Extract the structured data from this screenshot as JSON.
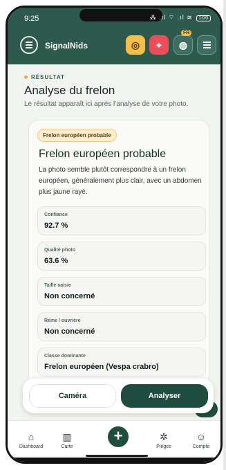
{
  "status": {
    "time": "9:25",
    "icons": "⁂ .ıl ⌔ .ıl ≋",
    "battery": "100"
  },
  "header": {
    "app_title": "SignalNids",
    "fr_badge": "FR",
    "buttons": [
      "target-icon",
      "pin-plus-icon",
      "globe-icon",
      "menu-icon"
    ]
  },
  "main": {
    "eyebrow": "RÉSULTAT",
    "title": "Analyse du frelon",
    "subtitle": "Le résultat apparaît ici après l’analyse de votre photo."
  },
  "result": {
    "pill": "Frelon européen probable",
    "title": "Frelon européen probable",
    "description": "La photo semble plutôt correspondre à un frelon européen, généralement plus clair, avec un abdomen plus jaune rayé.",
    "metrics": [
      {
        "label": "Confiance",
        "value": "92.7 %"
      },
      {
        "label": "Qualité photo",
        "value": "63.6 %"
      },
      {
        "label": "Taille saisie",
        "value": "Non concerné"
      },
      {
        "label": "Reine / ouvrière",
        "value": "Non concerné"
      },
      {
        "label": "Classe dominante",
        "value": "Frelon européen (Vespa crabro)"
      }
    ]
  },
  "actions": {
    "camera": "Caméra",
    "analyse": "Analyser"
  },
  "nav": {
    "items": [
      {
        "label": "Dashboard",
        "icon": "home-icon"
      },
      {
        "label": "Carte",
        "icon": "map-icon"
      },
      {
        "label": "Pièges",
        "icon": "bug-icon"
      },
      {
        "label": "Compte",
        "icon": "account-icon"
      }
    ],
    "add_icon": "plus-icon"
  },
  "colors": {
    "brand": "#2e5a4d",
    "accent_dark": "#1f4d40",
    "warning": "#f5c04a",
    "danger": "#ea4e58"
  }
}
